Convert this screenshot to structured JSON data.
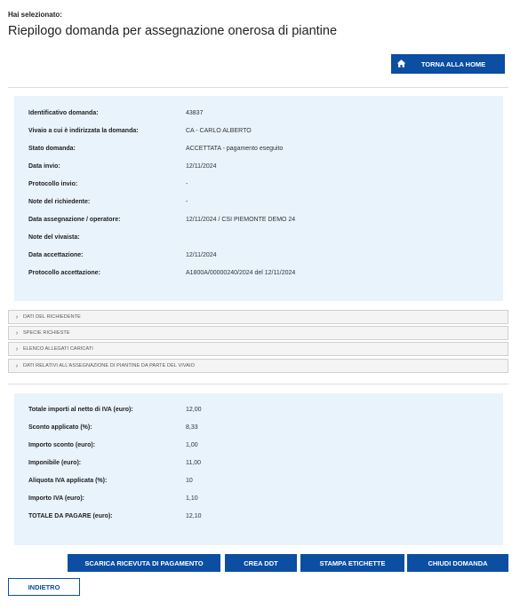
{
  "header": {
    "selected_label": "Hai selezionato:",
    "title": "Riepilogo domanda per assegnazione onerosa di piantine",
    "home_button": "TORNA ALLA HOME"
  },
  "details": [
    {
      "label": "Identificativo domanda:",
      "value": "43837"
    },
    {
      "label": "Vivaio a cui è indirizzata la domanda:",
      "value": "CA - CARLO ALBERTO"
    },
    {
      "label": "Stato domanda:",
      "value": "ACCETTATA - pagamento eseguito"
    },
    {
      "label": "Data invio:",
      "value": "12/11/2024"
    },
    {
      "label": "Protocollo invio:",
      "value": "-"
    },
    {
      "label": "Note del richiedente:",
      "value": "-"
    },
    {
      "label": "Data assegnazione / operatore:",
      "value": "12/11/2024 / CSI PIEMONTE DEMO 24"
    },
    {
      "label": "Note del vivaista:",
      "value": ""
    },
    {
      "label": "Data accettazione:",
      "value": "12/11/2024"
    },
    {
      "label": "Protocollo accettazione:",
      "value": "A1800A/00000240/2024 del 12/11/2024"
    }
  ],
  "accordions": [
    "DATI DEL RICHIEDENTE",
    "SPECIE RICHIESTE",
    "ELENCO ALLEGATI CARICATI",
    "DATI RELATIVI ALL'ASSEGNAZIONE DI PIANTINE DA PARTE DEL VIVAIO"
  ],
  "totals": [
    {
      "label": "Totale importi al netto di IVA (euro):",
      "value": "12,00"
    },
    {
      "label": "Sconto applicato (%):",
      "value": "8,33"
    },
    {
      "label": "Importo sconto (euro):",
      "value": "1,00"
    },
    {
      "label": "Imponibile (euro):",
      "value": "11,00"
    },
    {
      "label": "Aliquota IVA applicata (%):",
      "value": "10"
    },
    {
      "label": "Importo IVA (euro):",
      "value": "1,10"
    },
    {
      "label": "TOTALE DA PAGARE (euro):",
      "value": "12,10"
    }
  ],
  "actions": {
    "download_receipt": "SCARICA RICEVUTA DI PAGAMENTO",
    "create_ddt": "CREA DDT",
    "print_labels": "STAMPA ETICHETTE",
    "close_request": "CHIUDI DOMANDA",
    "back": "INDIETRO"
  },
  "colors": {
    "primary": "#0b4ea2",
    "panel_bg": "#e8f3fc"
  },
  "icons": {
    "home": "home-icon",
    "chevron": "chevron-right-icon"
  }
}
